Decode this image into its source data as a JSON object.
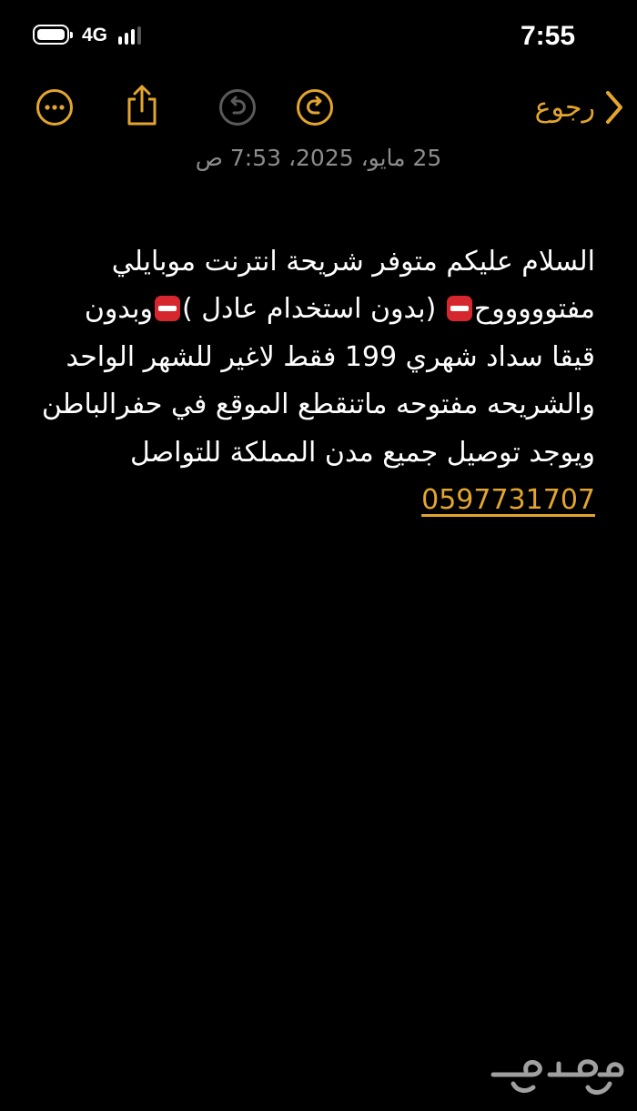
{
  "status_bar": {
    "network": "4G",
    "time": "7:55",
    "battery_icon": "battery-full-icon",
    "signal_icon": "cellular-signal-icon"
  },
  "toolbar": {
    "back_label": "رجوع",
    "more_icon": "ellipsis-circle-icon",
    "share_icon": "share-icon",
    "undo_icon": "undo-icon",
    "redo_icon": "redo-icon",
    "accent_color": "#e3a52e",
    "disabled_color": "#5a5a5a"
  },
  "note": {
    "date": "25 مايو، 2025، 7:53 ص",
    "lines": [
      "السلام عليكم متوفر شريحة انترنت موبايلي",
      "مفتوووووح",
      "(بدون استخدام عادل )",
      "وبدون",
      "قيقا سداد شهري 199 فقط لاغير  للشهر  الواحد",
      "والشريحه مفتوحه ماتنقطع الموقع في حفرالباطن",
      "ويوجد توصيل جميع مدن المملكة للتواصل"
    ],
    "phone": "0597731707"
  },
  "watermark": {
    "text": "حراج",
    "icon": "haraj-logo-watermark"
  }
}
